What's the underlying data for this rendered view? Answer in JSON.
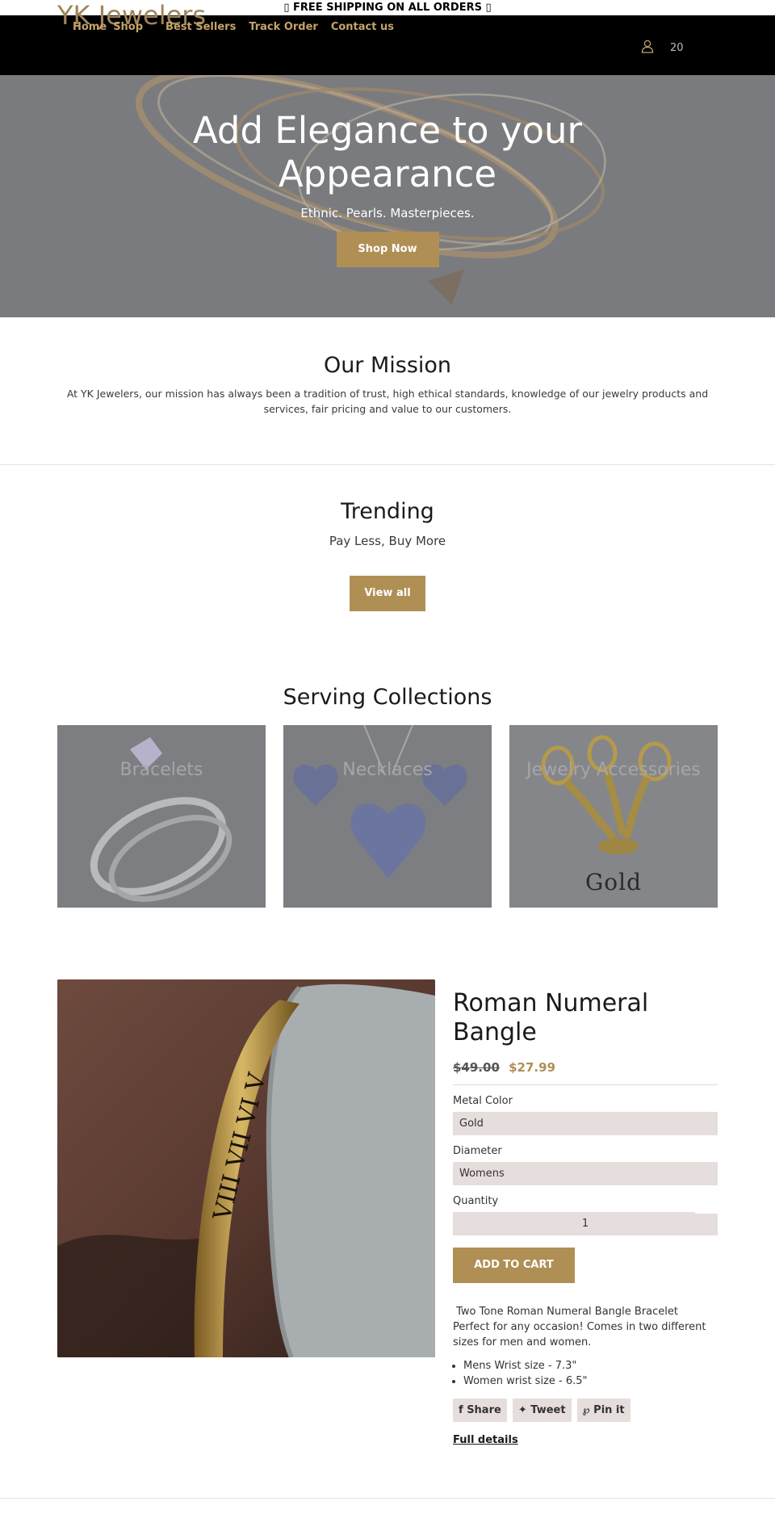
{
  "announcement": {
    "text": "▯ FREE SHIPPING ON ALL ORDERS ▯"
  },
  "header": {
    "logo": "YK Jewelers",
    "nav": [
      "Home",
      "Shop",
      "Best Sellers",
      "Track Order",
      "Contact us"
    ],
    "icons": {
      "account": "user-icon",
      "cart": "cart-icon"
    },
    "cart_count": "20"
  },
  "hero": {
    "title_line1": "Add Elegance to your",
    "title_line2": "Appearance",
    "subtitle": "Ethnic. Pearls. Masterpieces.",
    "button": "Shop Now"
  },
  "mission": {
    "title": "Our Mission",
    "text": "At YK Jewelers, our mission has always been a tradition of trust, high ethical standards, knowledge of our jewelry products and services, fair pricing and value to our customers."
  },
  "trending": {
    "title": "Trending",
    "subtitle": "Pay Less, Buy More",
    "button": "View all"
  },
  "collections": {
    "title": "Serving Collections",
    "items": [
      {
        "label": "Bracelets",
        "image_text": ""
      },
      {
        "label": "Necklaces",
        "image_text": ""
      },
      {
        "label": "Jewelry Accessories",
        "image_text": "Gold"
      }
    ]
  },
  "product": {
    "title": "Roman Numeral Bangle",
    "old_price": "$49.00",
    "new_price": "$27.99",
    "metal_label": "Metal Color",
    "metal_value": "Gold",
    "diameter_label": "Diameter",
    "diameter_value": "Womens",
    "quantity_label": "Quantity",
    "quantity_value": "1",
    "add_to_cart": "ADD TO CART",
    "description": "Two Tone Roman Numeral Bangle Bracelet Perfect for any occasion! Comes in two different sizes for men and women.",
    "bullets": [
      "Mens Wrist size - 7.3\"",
      "Women wrist size - 6.5\""
    ],
    "share": {
      "facebook": "Share",
      "twitter": "Tweet",
      "pinterest": "Pin it"
    },
    "full_details": "Full details"
  },
  "colors": {
    "gold": "#b08f55",
    "header_bg": "#000000",
    "nav_gold": "#c4a46a"
  }
}
